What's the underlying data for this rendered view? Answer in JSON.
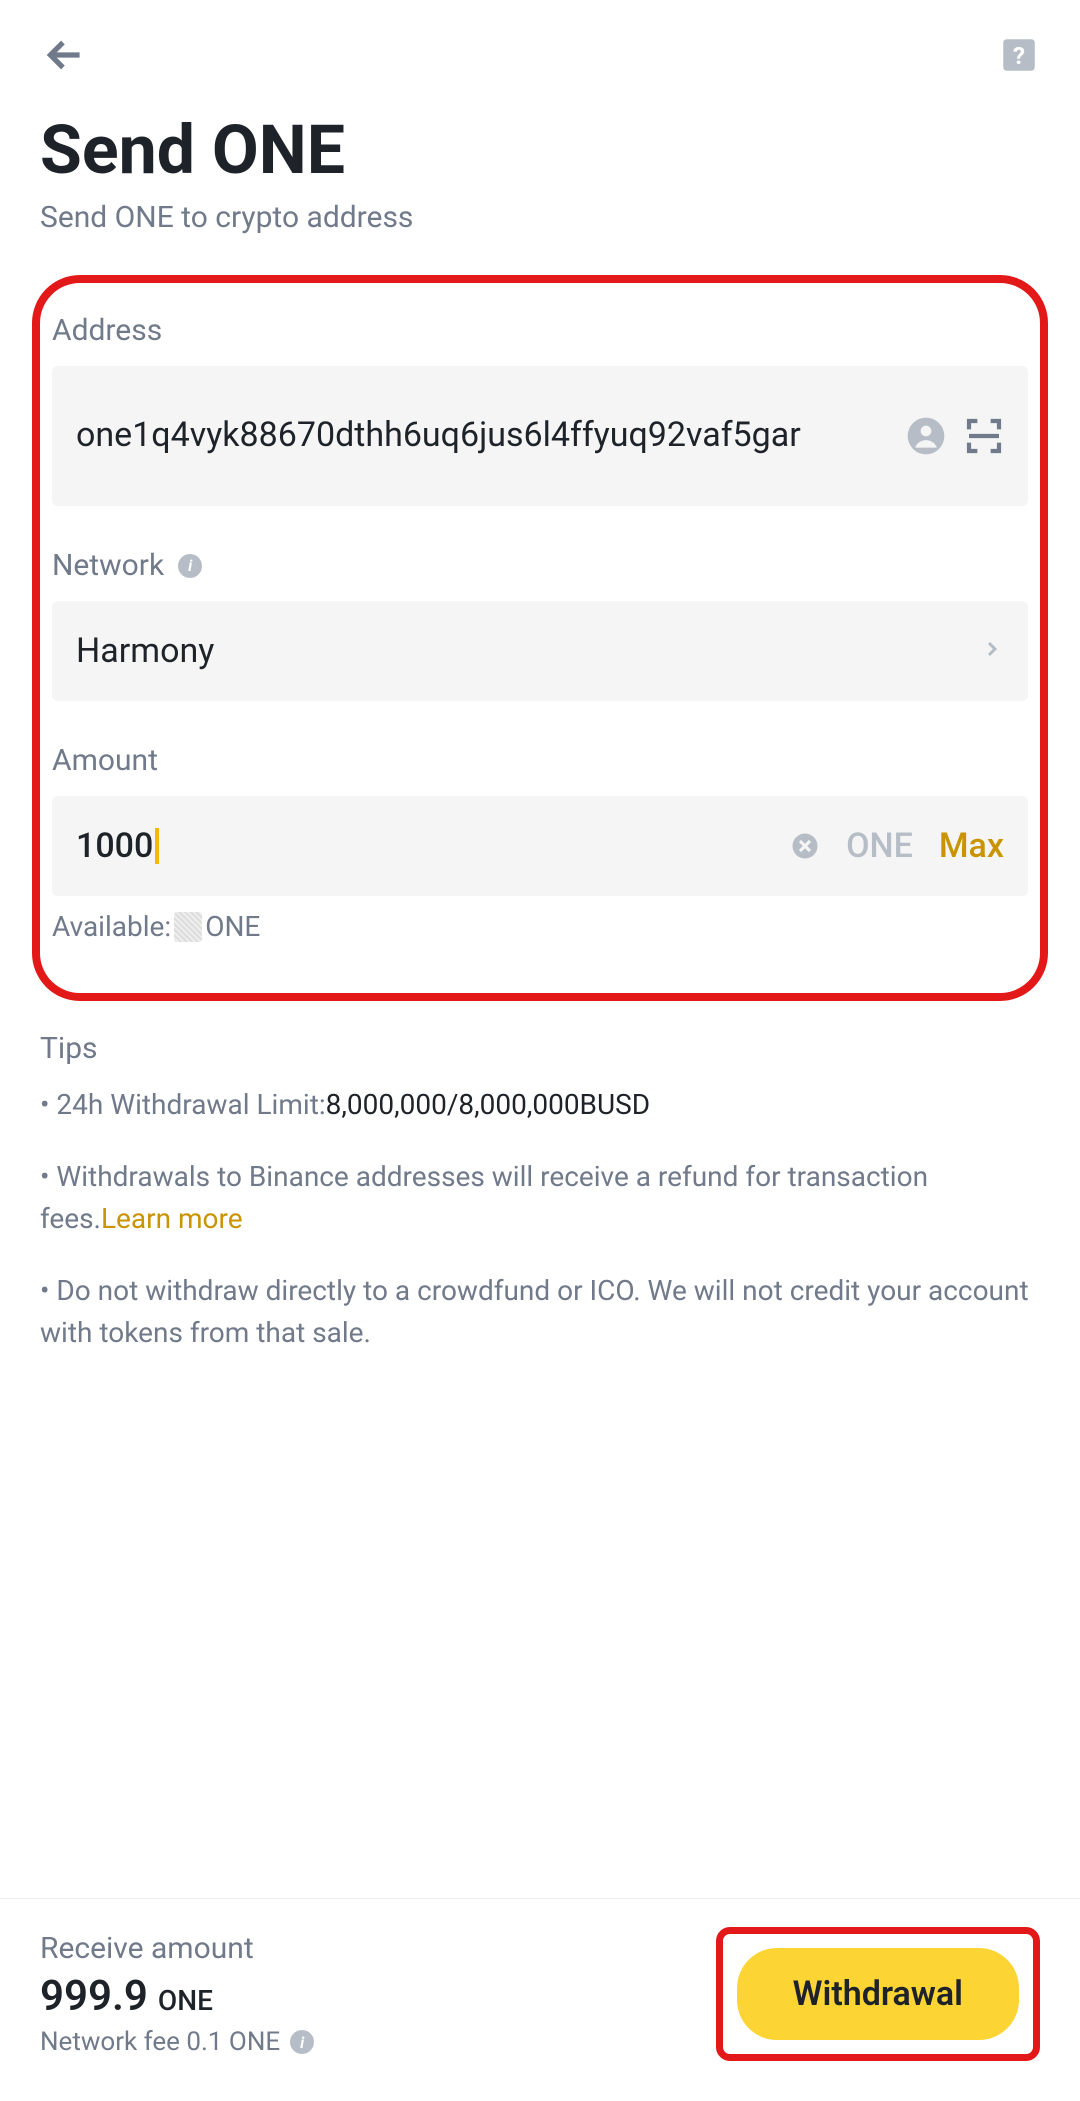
{
  "header": {
    "title": "Send ONE",
    "subtitle": "Send ONE to crypto address"
  },
  "fields": {
    "address": {
      "label": "Address",
      "value": "one1q4vyk88670dthh6uq6jus6l4ffyuq92vaf5gar"
    },
    "network": {
      "label": "Network",
      "value": "Harmony"
    },
    "amount": {
      "label": "Amount",
      "value": "1000",
      "unit": "ONE",
      "max_label": "Max",
      "available_prefix": "Available:",
      "available_unit": "ONE"
    }
  },
  "tips": {
    "title": "Tips",
    "line1_prefix": "• 24h Withdrawal Limit:",
    "line1_value": "8,000,000/8,000,000BUSD",
    "line2": "• Withdrawals to Binance addresses will receive a refund for transaction fees.",
    "learn_more": "Learn more",
    "line3": "• Do not withdraw directly to a crowdfund or ICO. We will not credit your account with tokens from that sale."
  },
  "footer": {
    "receive_label": "Receive amount",
    "receive_amount": "999.9",
    "receive_unit": "ONE",
    "fee_label": "Network fee 0.1 ONE",
    "button": "Withdrawal"
  }
}
